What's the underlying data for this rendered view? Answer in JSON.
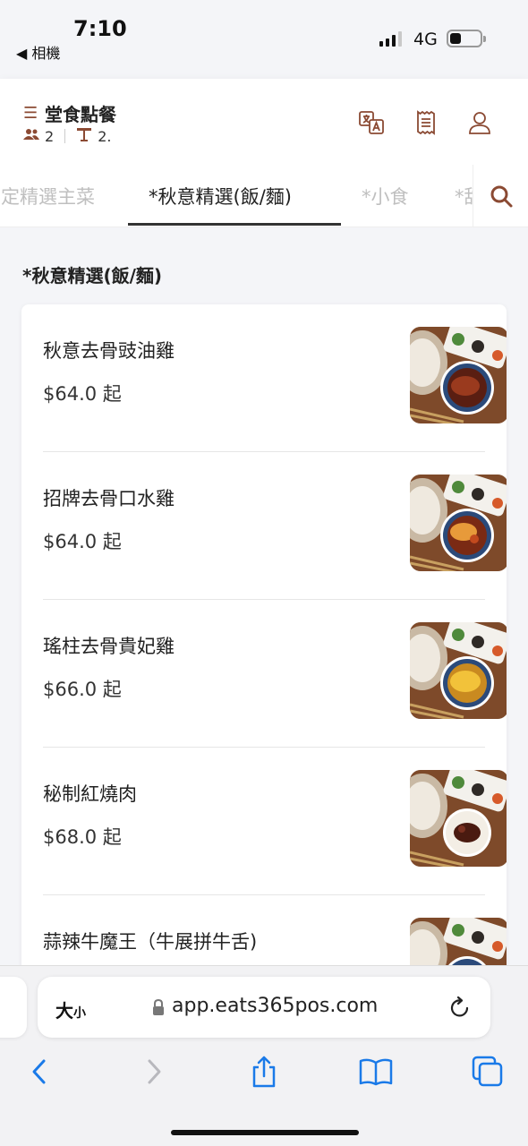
{
  "status_bar": {
    "time": "7:10",
    "back_label": "◀ 相機",
    "network": "4G"
  },
  "header": {
    "title": "堂食點餐",
    "guests": "2",
    "table": "2.",
    "icons": [
      "menu-icon",
      "translate-icon",
      "receipt-icon",
      "account-icon"
    ]
  },
  "tabs": [
    {
      "label": "定精選主菜",
      "active": false
    },
    {
      "label": "*秋意精選(飯/麵)",
      "active": true
    },
    {
      "label": "*小食",
      "active": false
    },
    {
      "label": "*甜",
      "active": false
    }
  ],
  "section": {
    "title": "*秋意精選(飯/麵)"
  },
  "items": [
    {
      "name": "秋意去骨豉油雞",
      "price": "$64.0 起"
    },
    {
      "name": "招牌去骨口水雞",
      "price": "$64.0 起"
    },
    {
      "name": "瑤柱去骨貴妃雞",
      "price": "$66.0 起"
    },
    {
      "name": "秘制紅燒肉",
      "price": "$68.0 起"
    },
    {
      "name": "蒜辣牛魔王（牛展拼牛舌)",
      "price": ""
    }
  ],
  "browser": {
    "text_size_label_big": "大",
    "text_size_label_small": "小",
    "url": "app.eats365pos.com"
  },
  "colors": {
    "accent": "#8b4a33",
    "ios_blue": "#1a7ae8",
    "background": "#f4f5f8"
  }
}
